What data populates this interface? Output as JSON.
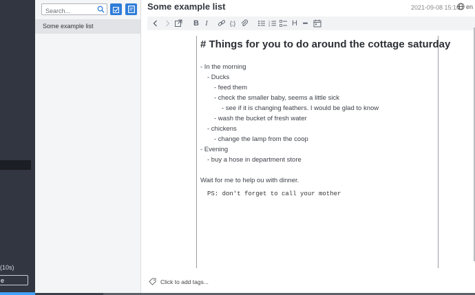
{
  "sidebar": {
    "count_text": "(10s)",
    "button_label": "e"
  },
  "note_list": {
    "search_placeholder": "Search...",
    "items": [
      {
        "title": "Some example list"
      }
    ]
  },
  "editor": {
    "title": "Some example list",
    "date": "2021-09-08 15:10",
    "language": "en",
    "heading": "# Things for you to do around the cottage saturday",
    "lines": [
      {
        "indent": 0,
        "text": "- In the morning"
      },
      {
        "indent": 1,
        "text": "- Ducks"
      },
      {
        "indent": 2,
        "text": "- feed them"
      },
      {
        "indent": 2,
        "text": "- check the smaller baby, seems a little sick"
      },
      {
        "indent": 3,
        "text": "- see if it is changing feathers. I would be glad to know"
      },
      {
        "indent": 2,
        "text": "- wash the bucket of fresh water"
      },
      {
        "indent": 1,
        "text": "- chickens"
      },
      {
        "indent": 2,
        "text": "- change the lamp from the coop"
      },
      {
        "indent": 0,
        "text": "- Evening"
      },
      {
        "indent": 1,
        "text": "- buy a hose in department store"
      }
    ],
    "paragraph": "Wait for me to help ou with dinner.",
    "ps": "PS: don't forget to call your mother",
    "tags_placeholder": "Click to add tags..."
  },
  "toolbar_icons": [
    "back-icon",
    "forward-icon",
    "external-edit-icon",
    "bold-icon",
    "italic-icon",
    "link-icon",
    "code-icon",
    "attach-icon",
    "bullet-list-icon",
    "numbered-list-icon",
    "checkbox-list-icon",
    "heading-icon",
    "more-icon",
    "insert-datetime-icon"
  ],
  "colors": {
    "accent": "#2e7cd8",
    "sidebar_bg": "#313640",
    "list_bg": "#f4f5f6",
    "selected_item": "#e1e3e7"
  }
}
